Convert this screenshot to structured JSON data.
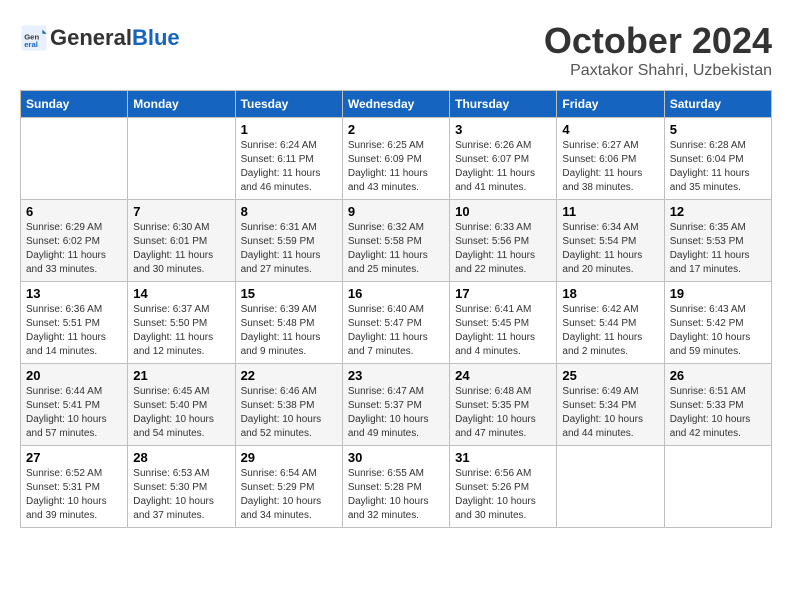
{
  "logo": {
    "text_general": "General",
    "text_blue": "Blue"
  },
  "title": {
    "month": "October 2024",
    "location": "Paxtakor Shahri, Uzbekistan"
  },
  "days_of_week": [
    "Sunday",
    "Monday",
    "Tuesday",
    "Wednesday",
    "Thursday",
    "Friday",
    "Saturday"
  ],
  "weeks": [
    [
      {
        "day": "",
        "info": ""
      },
      {
        "day": "",
        "info": ""
      },
      {
        "day": "1",
        "info": "Sunrise: 6:24 AM\nSunset: 6:11 PM\nDaylight: 11 hours and 46 minutes."
      },
      {
        "day": "2",
        "info": "Sunrise: 6:25 AM\nSunset: 6:09 PM\nDaylight: 11 hours and 43 minutes."
      },
      {
        "day": "3",
        "info": "Sunrise: 6:26 AM\nSunset: 6:07 PM\nDaylight: 11 hours and 41 minutes."
      },
      {
        "day": "4",
        "info": "Sunrise: 6:27 AM\nSunset: 6:06 PM\nDaylight: 11 hours and 38 minutes."
      },
      {
        "day": "5",
        "info": "Sunrise: 6:28 AM\nSunset: 6:04 PM\nDaylight: 11 hours and 35 minutes."
      }
    ],
    [
      {
        "day": "6",
        "info": "Sunrise: 6:29 AM\nSunset: 6:02 PM\nDaylight: 11 hours and 33 minutes."
      },
      {
        "day": "7",
        "info": "Sunrise: 6:30 AM\nSunset: 6:01 PM\nDaylight: 11 hours and 30 minutes."
      },
      {
        "day": "8",
        "info": "Sunrise: 6:31 AM\nSunset: 5:59 PM\nDaylight: 11 hours and 27 minutes."
      },
      {
        "day": "9",
        "info": "Sunrise: 6:32 AM\nSunset: 5:58 PM\nDaylight: 11 hours and 25 minutes."
      },
      {
        "day": "10",
        "info": "Sunrise: 6:33 AM\nSunset: 5:56 PM\nDaylight: 11 hours and 22 minutes."
      },
      {
        "day": "11",
        "info": "Sunrise: 6:34 AM\nSunset: 5:54 PM\nDaylight: 11 hours and 20 minutes."
      },
      {
        "day": "12",
        "info": "Sunrise: 6:35 AM\nSunset: 5:53 PM\nDaylight: 11 hours and 17 minutes."
      }
    ],
    [
      {
        "day": "13",
        "info": "Sunrise: 6:36 AM\nSunset: 5:51 PM\nDaylight: 11 hours and 14 minutes."
      },
      {
        "day": "14",
        "info": "Sunrise: 6:37 AM\nSunset: 5:50 PM\nDaylight: 11 hours and 12 minutes."
      },
      {
        "day": "15",
        "info": "Sunrise: 6:39 AM\nSunset: 5:48 PM\nDaylight: 11 hours and 9 minutes."
      },
      {
        "day": "16",
        "info": "Sunrise: 6:40 AM\nSunset: 5:47 PM\nDaylight: 11 hours and 7 minutes."
      },
      {
        "day": "17",
        "info": "Sunrise: 6:41 AM\nSunset: 5:45 PM\nDaylight: 11 hours and 4 minutes."
      },
      {
        "day": "18",
        "info": "Sunrise: 6:42 AM\nSunset: 5:44 PM\nDaylight: 11 hours and 2 minutes."
      },
      {
        "day": "19",
        "info": "Sunrise: 6:43 AM\nSunset: 5:42 PM\nDaylight: 10 hours and 59 minutes."
      }
    ],
    [
      {
        "day": "20",
        "info": "Sunrise: 6:44 AM\nSunset: 5:41 PM\nDaylight: 10 hours and 57 minutes."
      },
      {
        "day": "21",
        "info": "Sunrise: 6:45 AM\nSunset: 5:40 PM\nDaylight: 10 hours and 54 minutes."
      },
      {
        "day": "22",
        "info": "Sunrise: 6:46 AM\nSunset: 5:38 PM\nDaylight: 10 hours and 52 minutes."
      },
      {
        "day": "23",
        "info": "Sunrise: 6:47 AM\nSunset: 5:37 PM\nDaylight: 10 hours and 49 minutes."
      },
      {
        "day": "24",
        "info": "Sunrise: 6:48 AM\nSunset: 5:35 PM\nDaylight: 10 hours and 47 minutes."
      },
      {
        "day": "25",
        "info": "Sunrise: 6:49 AM\nSunset: 5:34 PM\nDaylight: 10 hours and 44 minutes."
      },
      {
        "day": "26",
        "info": "Sunrise: 6:51 AM\nSunset: 5:33 PM\nDaylight: 10 hours and 42 minutes."
      }
    ],
    [
      {
        "day": "27",
        "info": "Sunrise: 6:52 AM\nSunset: 5:31 PM\nDaylight: 10 hours and 39 minutes."
      },
      {
        "day": "28",
        "info": "Sunrise: 6:53 AM\nSunset: 5:30 PM\nDaylight: 10 hours and 37 minutes."
      },
      {
        "day": "29",
        "info": "Sunrise: 6:54 AM\nSunset: 5:29 PM\nDaylight: 10 hours and 34 minutes."
      },
      {
        "day": "30",
        "info": "Sunrise: 6:55 AM\nSunset: 5:28 PM\nDaylight: 10 hours and 32 minutes."
      },
      {
        "day": "31",
        "info": "Sunrise: 6:56 AM\nSunset: 5:26 PM\nDaylight: 10 hours and 30 minutes."
      },
      {
        "day": "",
        "info": ""
      },
      {
        "day": "",
        "info": ""
      }
    ]
  ]
}
